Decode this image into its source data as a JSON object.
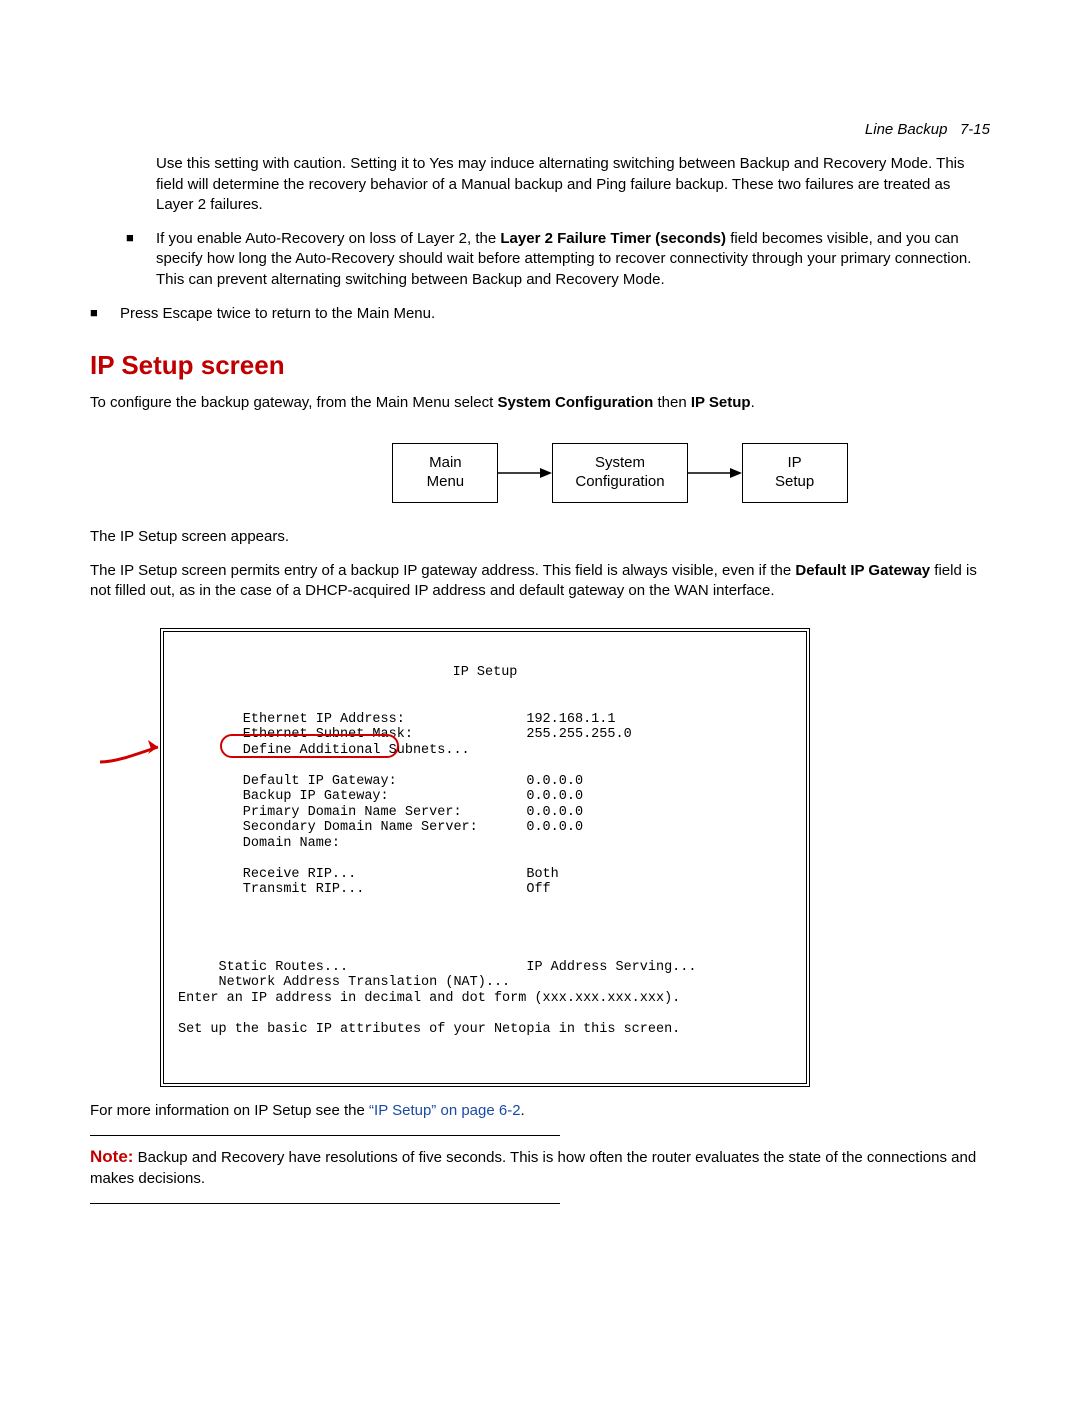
{
  "header": {
    "section": "Line Backup",
    "page": "7-15"
  },
  "intro_para": "Use this setting with caution. Setting it to Yes may induce alternating switching between Backup and Recovery Mode. This field will determine the recovery behavior of a Manual backup and Ping failure backup. These two failures are treated as Layer 2 failures.",
  "bullet_auto_recovery": {
    "lead": "If you enable Auto-Recovery on loss of Layer 2, the ",
    "bold_field": "Layer 2 Failure Timer (seconds)",
    "tail": " field becomes visible, and you can specify how long the Auto-Recovery should wait before attempting to recover connectivity through your primary connection. This can prevent alternating switching between Backup and Recovery Mode."
  },
  "bullet_escape": "Press Escape twice to return to the Main Menu.",
  "section_title": "IP Setup screen",
  "config_para": {
    "lead": "To configure the backup gateway, from the Main Menu select ",
    "bold1": "System Configuration",
    "mid": " then ",
    "bold2": "IP Setup",
    "end": "."
  },
  "nav": {
    "box1_line1": "Main",
    "box1_line2": "Menu",
    "box2_line1": "System",
    "box2_line2": "Configuration",
    "box3_line1": "IP",
    "box3_line2": "Setup"
  },
  "after_nav1": "The IP Setup screen appears.",
  "after_nav2": {
    "lead": "The IP Setup screen permits entry of a backup IP gateway address. This field is always visible, even if the ",
    "bold": "Default IP Gateway",
    "tail": " field is not filled out, as in the case of a DHCP-acquired IP address and default gateway on the WAN interface."
  },
  "terminal": {
    "title": "IP Setup",
    "rows": [
      {
        "label": "Ethernet IP Address:",
        "value": "192.168.1.1"
      },
      {
        "label": "Ethernet Subnet Mask:",
        "value": "255.255.255.0"
      },
      {
        "label": "Define Additional Subnets...",
        "value": ""
      },
      {
        "label": "",
        "value": ""
      },
      {
        "label": "Default IP Gateway:",
        "value": "0.0.0.0"
      },
      {
        "label": "Backup IP Gateway:",
        "value": "0.0.0.0"
      },
      {
        "label": "Primary Domain Name Server:",
        "value": "0.0.0.0"
      },
      {
        "label": "Secondary Domain Name Server:",
        "value": "0.0.0.0"
      },
      {
        "label": "Domain Name:",
        "value": ""
      },
      {
        "label": "",
        "value": ""
      },
      {
        "label": "Receive RIP...",
        "value": "Both"
      },
      {
        "label": "Transmit RIP...",
        "value": "Off"
      }
    ],
    "bottom_left1": "Static Routes...",
    "bottom_right1": "IP Address Serving...",
    "bottom_left2": "Network Address Translation (NAT)...",
    "footer1": "Enter an IP address in decimal and dot form (xxx.xxx.xxx.xxx).",
    "footer2": "Set up the basic IP attributes of your Netopia in this screen."
  },
  "more_info": {
    "lead": "For more information on IP Setup see the ",
    "link": "“IP Setup” on page 6-2",
    "end": "."
  },
  "note": {
    "label": "Note:",
    "text": "  Backup and Recovery have resolutions of five seconds. This is how often the router evaluates the state of the connections and makes decisions."
  }
}
